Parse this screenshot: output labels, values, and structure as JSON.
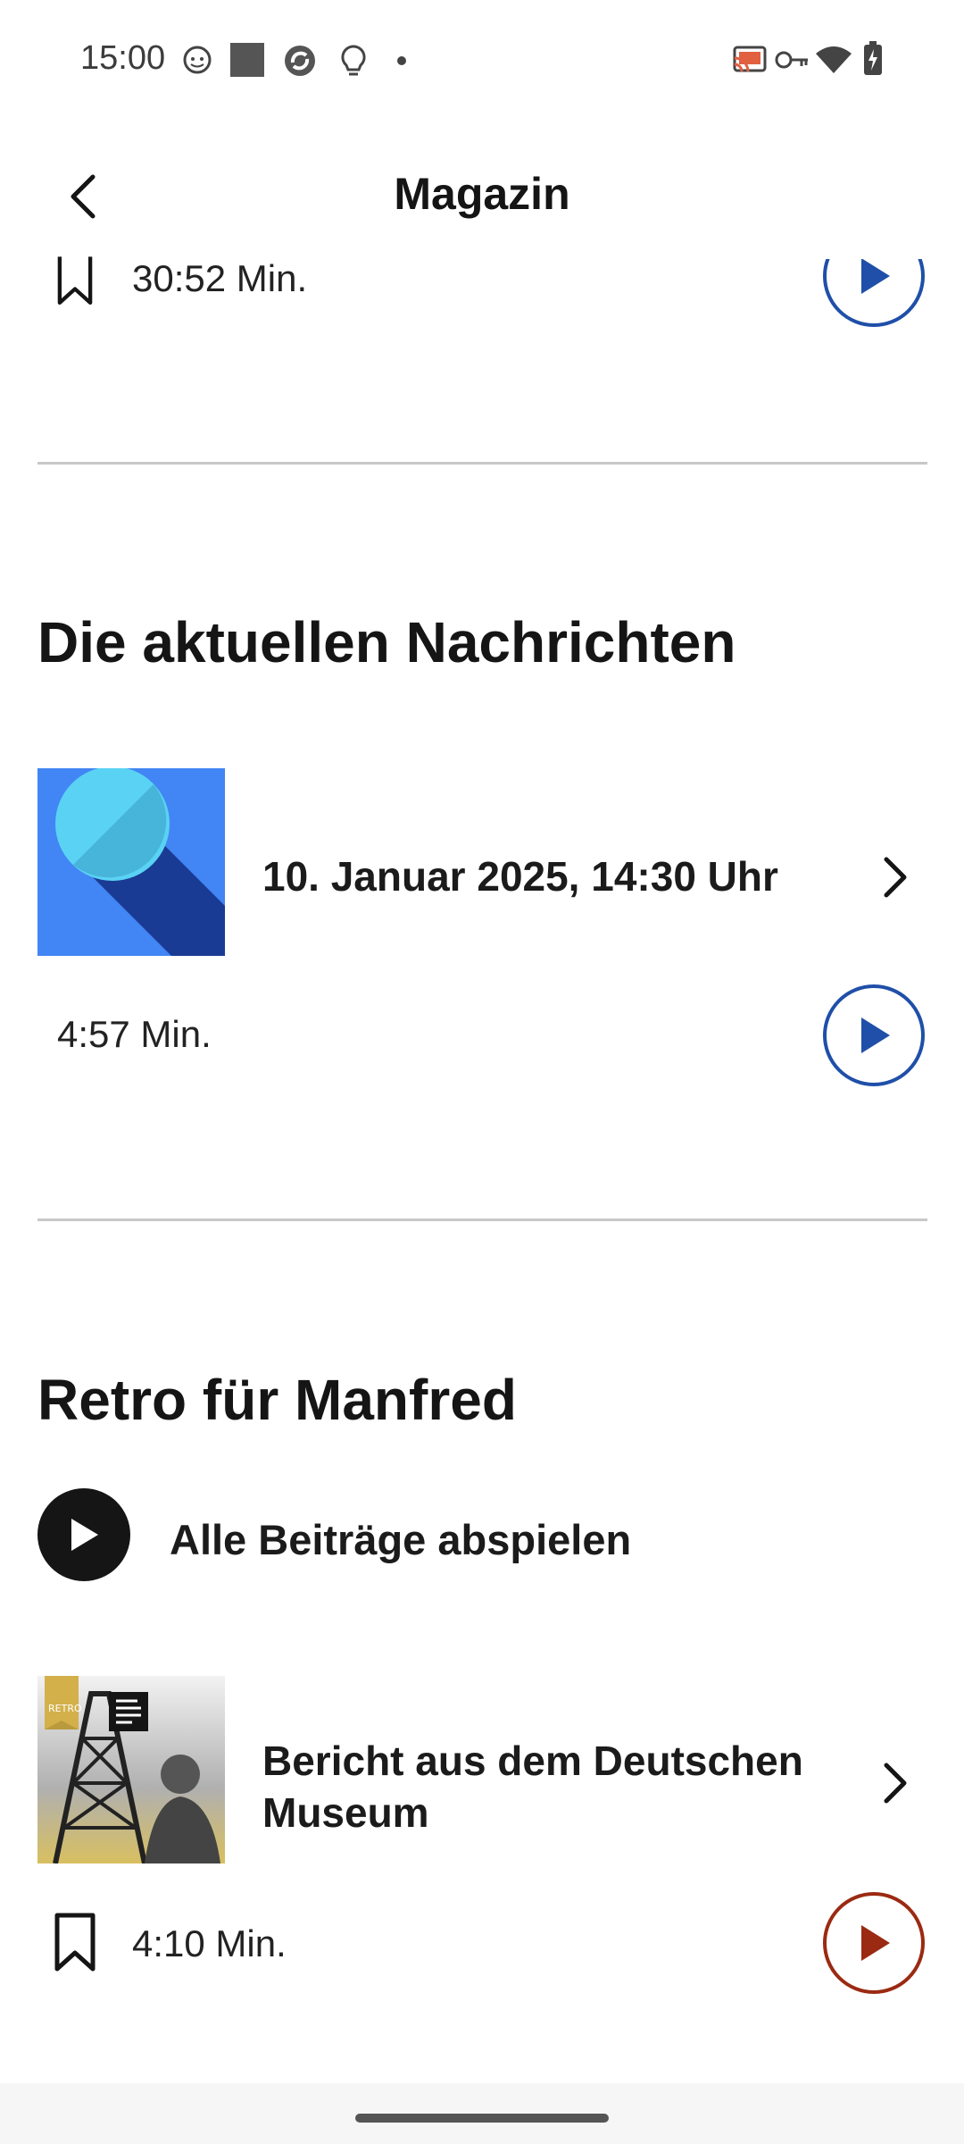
{
  "status_bar": {
    "time": "15:00",
    "left_icons": [
      "cat-face-icon",
      "square-icon",
      "circular-arrows-icon",
      "lightbulb-icon",
      "dot-icon"
    ],
    "right_icons": [
      "cast-icon",
      "key-icon",
      "wifi-icon",
      "battery-charging-icon"
    ]
  },
  "header": {
    "title": "Magazin",
    "back_icon": "chevron-left-icon"
  },
  "top_item": {
    "duration": "30:52 Min.",
    "bookmark_icon": "bookmark-outline-icon",
    "play_icon": "play-icon"
  },
  "news_section": {
    "title": "Die aktuellen Nachrichten",
    "item": {
      "title": "10. Januar 2025, 14:30 Uhr",
      "duration": "4:57 Min.",
      "colors": {
        "thumb_bg": "#4285f4",
        "thumb_shadow": "#1a3b93",
        "thumb_circle": "#5ad2f4",
        "play_accent": "#1f4fa8"
      }
    }
  },
  "retro_section": {
    "title": "Retro für Manfred",
    "play_all_label": "Alle Beiträge abspielen",
    "item": {
      "title_line1": "Bericht aus dem Deutschen",
      "title_line2": "Museum",
      "duration": "4:10 Min.",
      "thumb_badge": "RETRO",
      "colors": {
        "badge": "#d4b04a",
        "play_accent": "#9b2a12"
      }
    }
  }
}
